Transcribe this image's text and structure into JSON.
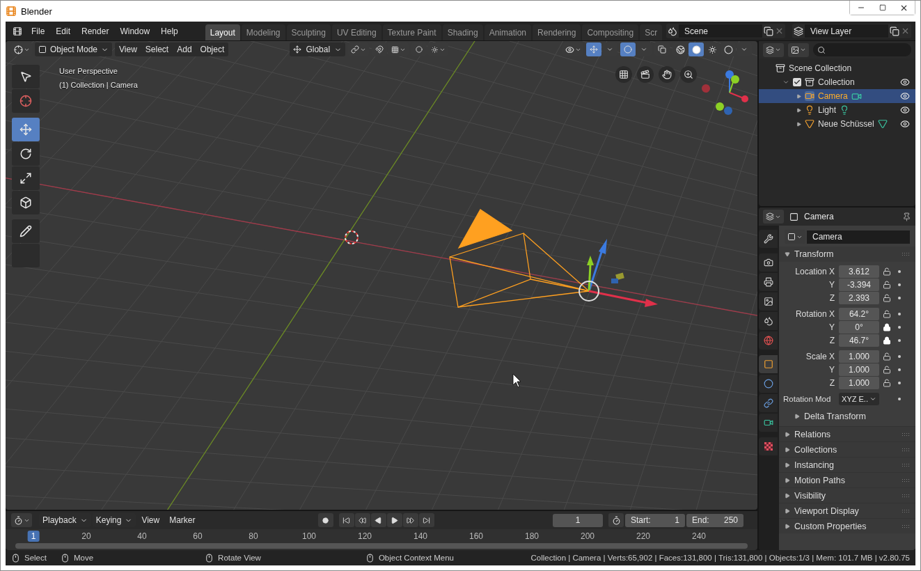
{
  "window": {
    "title": "Blender"
  },
  "menu": [
    "File",
    "Edit",
    "Render",
    "Window",
    "Help"
  ],
  "workspaces": [
    {
      "label": "Layout",
      "selected": true
    },
    {
      "label": "Modeling",
      "selected": false
    },
    {
      "label": "Sculpting",
      "selected": false
    },
    {
      "label": "UV Editing",
      "selected": false
    },
    {
      "label": "Texture Paint",
      "selected": false
    },
    {
      "label": "Shading",
      "selected": false
    },
    {
      "label": "Animation",
      "selected": false
    },
    {
      "label": "Rendering",
      "selected": false
    },
    {
      "label": "Compositing",
      "selected": false
    },
    {
      "label": "Scr",
      "selected": false
    }
  ],
  "scene": "Scene",
  "view_layer": "View Layer",
  "viewport": {
    "mode": "Object Mode",
    "menus": [
      "View",
      "Select",
      "Add",
      "Object"
    ],
    "orientation": "Global",
    "shading_modes": [
      {
        "selected": false
      },
      {
        "selected": true
      },
      {
        "selected": false
      },
      {
        "selected": false
      }
    ],
    "info": [
      "User Perspective",
      "(1) Collection | Camera"
    ],
    "tools": [
      {
        "selected": false
      },
      {
        "selected": false
      },
      {
        "selected": true
      },
      {
        "selected": false
      },
      {
        "selected": false
      },
      {
        "selected": false
      },
      {
        "selected": false
      },
      {
        "selected": false
      }
    ]
  },
  "outliner": {
    "root": "Scene Collection",
    "children": [
      {
        "name": "Collection",
        "kind": "collection",
        "checked": true,
        "expanded": true,
        "selected": false,
        "children": [
          {
            "name": "Camera",
            "kind": "camera",
            "selected": true
          },
          {
            "name": "Light",
            "kind": "light",
            "selected": false
          },
          {
            "name": "Neue Schüssel",
            "kind": "mesh",
            "selected": false
          }
        ]
      }
    ]
  },
  "properties": {
    "title": "Camera",
    "object_name": "Camera",
    "tabs": [
      {
        "selected": false
      },
      {
        "selected": false
      },
      {
        "selected": false
      },
      {
        "selected": false
      },
      {
        "selected": false
      },
      {
        "selected": false
      },
      {
        "selected": true
      },
      {
        "selected": false
      },
      {
        "selected": false
      },
      {
        "selected": false
      },
      {
        "selected": false
      }
    ],
    "transform": {
      "title": "Transform",
      "expanded": true,
      "groups": [
        {
          "rows": [
            {
              "label": "Location X",
              "value": "3.612",
              "locked": false
            },
            {
              "label": "Y",
              "value": "-3.394",
              "locked": false
            },
            {
              "label": "Z",
              "value": "2.393",
              "locked": false
            }
          ]
        },
        {
          "rows": [
            {
              "label": "Rotation X",
              "value": "64.2°",
              "locked": false
            },
            {
              "label": "Y",
              "value": "0°",
              "locked": true
            },
            {
              "label": "Z",
              "value": "46.7°",
              "locked": true
            }
          ]
        },
        {
          "rows": [
            {
              "label": "Scale X",
              "value": "1.000",
              "locked": false
            },
            {
              "label": "Y",
              "value": "1.000",
              "locked": false
            },
            {
              "label": "Z",
              "value": "1.000",
              "locked": false
            }
          ]
        }
      ],
      "rotation_mode": {
        "label": "Rotation Mod",
        "value": "XYZ E.."
      },
      "subpanels": [
        {
          "title": "Delta Transform",
          "expanded": false
        }
      ]
    },
    "panels": [
      {
        "title": "Relations",
        "expanded": false
      },
      {
        "title": "Collections",
        "expanded": false
      },
      {
        "title": "Instancing",
        "expanded": false
      },
      {
        "title": "Motion Paths",
        "expanded": false
      },
      {
        "title": "Visibility",
        "expanded": false
      },
      {
        "title": "Viewport Display",
        "expanded": false
      },
      {
        "title": "Custom Properties",
        "expanded": false
      }
    ]
  },
  "timeline": {
    "menus": [
      "Playback",
      "Keying",
      "View",
      "Marker"
    ],
    "current_frame": "1",
    "start_label": "Start:",
    "start": "1",
    "end_label": "End:",
    "end": "250",
    "ruler": [
      {
        "label": "1",
        "selected": true
      },
      {
        "label": "20",
        "selected": false
      },
      {
        "label": "40",
        "selected": false
      },
      {
        "label": "60",
        "selected": false
      },
      {
        "label": "80",
        "selected": false
      },
      {
        "label": "100",
        "selected": false
      },
      {
        "label": "120",
        "selected": false
      },
      {
        "label": "140",
        "selected": false
      },
      {
        "label": "160",
        "selected": false
      },
      {
        "label": "180",
        "selected": false
      },
      {
        "label": "200",
        "selected": false
      },
      {
        "label": "220",
        "selected": false
      },
      {
        "label": "240",
        "selected": false
      }
    ]
  },
  "status_bar": {
    "hints": [
      "Select",
      "Move",
      "Rotate View",
      "Object Context Menu"
    ],
    "stats": "Collection | Camera | Verts:65,902 | Faces:131,800 | Tris:131,800 | Objects:1/3 | Mem: 101.7 MB | v2.80.75"
  }
}
